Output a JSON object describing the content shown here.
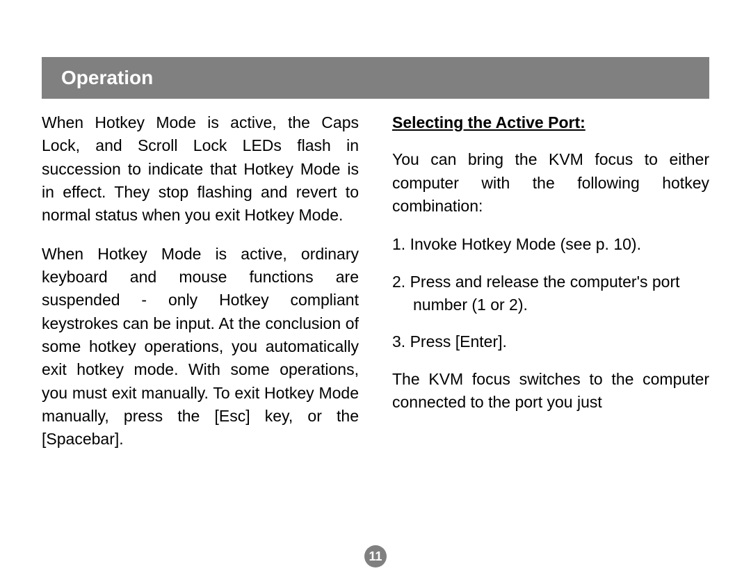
{
  "header": "Operation",
  "leftColumn": {
    "p1": "When Hotkey Mode is active, the Caps Lock, and Scroll Lock LEDs flash in succession to indicate that Hotkey Mode is in effect. They stop flashing and revert to normal status when you exit Hotkey Mode.",
    "p2": "When Hotkey Mode is active, ordinary keyboard and mouse functions are suspended - only Hotkey compliant keystrokes can be input. At the conclusion of some hotkey operations, you automatically exit hotkey mode. With some operations, you must exit manually. To exit Hotkey Mode manually, press the [Esc] key, or the [Spacebar]."
  },
  "rightColumn": {
    "subhead": "Selecting the Active Port:",
    "intro": "You can bring the KVM focus to either computer with the following hotkey combination:",
    "step1": "1. Invoke Hotkey Mode (see p. 10).",
    "step2": "2. Press and release the computer's port number (1 or 2).",
    "step3": "3. Press [Enter].",
    "outro": "The KVM focus switches to the computer connected to the port you just"
  },
  "pageNumber": "11"
}
